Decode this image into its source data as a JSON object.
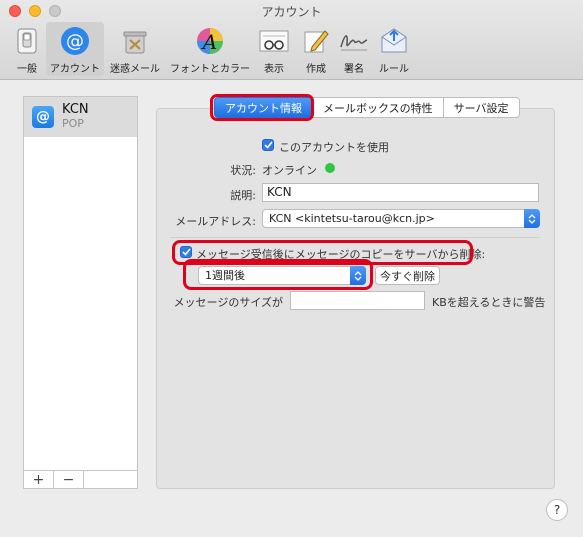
{
  "window": {
    "title": "アカウント"
  },
  "toolbar": {
    "items": [
      {
        "label": "一般",
        "icon": "switch-icon"
      },
      {
        "label": "アカウント",
        "icon": "at-icon"
      },
      {
        "label": "迷惑メール",
        "icon": "trash-icon"
      },
      {
        "label": "フォントとカラー",
        "icon": "font-color-icon"
      },
      {
        "label": "表示",
        "icon": "glasses-icon"
      },
      {
        "label": "作成",
        "icon": "pencil-icon"
      },
      {
        "label": "署名",
        "icon": "signature-icon"
      },
      {
        "label": "ルール",
        "icon": "rules-icon"
      }
    ],
    "active_index": 1
  },
  "accounts": [
    {
      "name": "KCN",
      "type": "POP"
    }
  ],
  "list_buttons": {
    "add": "+",
    "remove": "−"
  },
  "tabs": [
    {
      "label": "アカウント情報",
      "selected": true
    },
    {
      "label": "メールボックスの特性",
      "selected": false
    },
    {
      "label": "サーバ設定",
      "selected": false
    }
  ],
  "form": {
    "use_account_label": "このアカウントを使用",
    "use_account_checked": true,
    "status_label": "状況:",
    "status_value": "オンライン",
    "status_color": "#2fc840",
    "description_label": "説明:",
    "description_value": "KCN",
    "email_label": "メールアドレス:",
    "email_value": "KCN <kintetsu-tarou@kcn.jp>",
    "remove_copy_label": "メッセージ受信後にメッセージのコピーをサーバから削除:",
    "remove_copy_checked": true,
    "remove_after_value": "1週間後",
    "remove_now_button": "今すぐ削除",
    "size_label": "メッセージのサイズが",
    "size_value": "",
    "size_suffix": "KBを超えるときに警告"
  },
  "help_button": "?",
  "accent_color": "#1f6fe3",
  "highlight_color": "#e1001a"
}
